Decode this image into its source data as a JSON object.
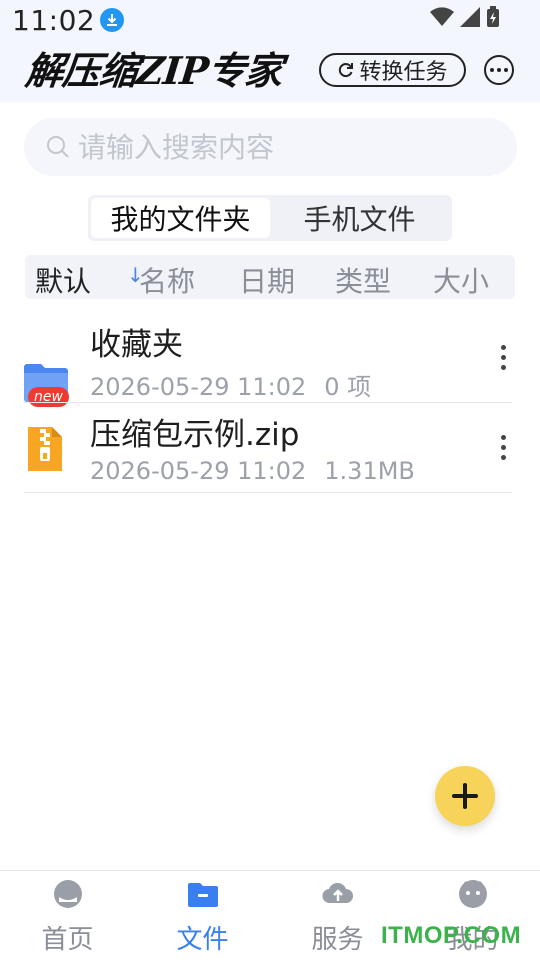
{
  "status_bar": {
    "time": "11:02"
  },
  "header": {
    "app_name": "解压缩ZIP专家",
    "convert_button": "转换任务"
  },
  "search": {
    "placeholder": "请输入搜索内容"
  },
  "tabs": [
    {
      "label": "我的文件夹",
      "active": true
    },
    {
      "label": "手机文件",
      "active": false
    }
  ],
  "sort": {
    "items": [
      {
        "label": "默认",
        "active": true
      },
      {
        "label": "名称",
        "active": false
      },
      {
        "label": "日期",
        "active": false
      },
      {
        "label": "类型",
        "active": false
      },
      {
        "label": "大小",
        "active": false
      }
    ],
    "arrow": "↓"
  },
  "files": [
    {
      "name": "收藏夹",
      "date": "2026-05-29 11:02",
      "extra": "0 项",
      "badge": "new",
      "icon": "folder-icon"
    },
    {
      "name": "压缩包示例.zip",
      "date": "2026-05-29 11:02",
      "extra": "1.31MB",
      "icon": "zip-file-icon"
    }
  ],
  "bottom_nav": [
    {
      "label": "首页",
      "icon": "home-icon",
      "active": false
    },
    {
      "label": "文件",
      "icon": "folder-minus-icon",
      "active": true
    },
    {
      "label": "服务",
      "icon": "cloud-upload-icon",
      "active": false
    },
    {
      "label": "我的",
      "icon": "user-face-icon",
      "active": false
    }
  ],
  "watermark": "ITMOP.COM",
  "colors": {
    "accent": "#3a7ff0",
    "fab": "#f7d35a",
    "badge": "#ef3b2f",
    "header_bg": "#f3f6fc"
  }
}
